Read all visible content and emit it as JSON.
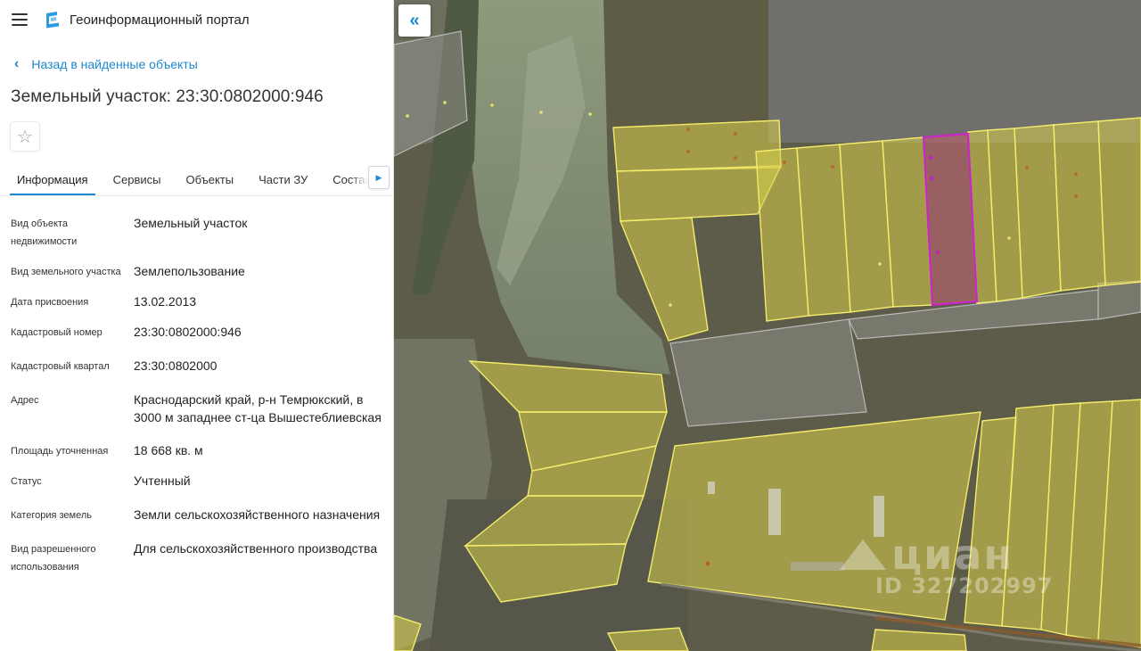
{
  "header": {
    "title": "Геоинформационный портал",
    "menu_icon": "hamburger-icon",
    "logo_icon": "portal-logo-icon"
  },
  "back_link": {
    "label": "Назад в найденные объекты",
    "icon": "chevron-left-icon"
  },
  "object": {
    "title": "Земельный участок: 23:30:0802000:946"
  },
  "favorite": {
    "icon": "star-icon",
    "glyph": "☆"
  },
  "tabs": [
    {
      "label": "Информация",
      "active": true
    },
    {
      "label": "Сервисы"
    },
    {
      "label": "Объекты"
    },
    {
      "label": "Части ЗУ"
    },
    {
      "label": "Состав"
    }
  ],
  "tabs_next_glyph": "▶",
  "properties": [
    {
      "label": "Вид объекта недвижимости",
      "value": "Земельный участок"
    },
    {
      "label": "Вид земельного участка",
      "value": "Землепользование"
    },
    {
      "label": "Дата присвоения",
      "value": "13.02.2013"
    },
    {
      "label": "Кадастровый номер",
      "value": "23:30:0802000:946"
    },
    {
      "label": "Кадастровый квартал",
      "value": "23:30:0802000"
    },
    {
      "label": "Адрес",
      "value": "Краснодарский край, р-н Темрюкский, в 3000 м западнее ст-ца Вышестеблиевская"
    },
    {
      "label": "Площадь уточненная",
      "value": "18 668 кв. м"
    },
    {
      "label": "Статус",
      "value": "Учтенный"
    },
    {
      "label": "Категория земель",
      "value": "Земли сельскохозяйственного назначения"
    },
    {
      "label": "Вид разрешенного использования",
      "value": "Для сельскохозяйственного производства"
    }
  ],
  "map": {
    "collapse_glyph": "«",
    "watermark_brand": "циан",
    "watermark_id": "ID 327202997",
    "colors": {
      "parcel_fill": "#d8cf4a",
      "parcel_stroke": "#f4ec6a",
      "selected_fill": "#b3636b",
      "selected_stroke": "#d21fd2",
      "field_bg": "#6f6c52"
    }
  }
}
